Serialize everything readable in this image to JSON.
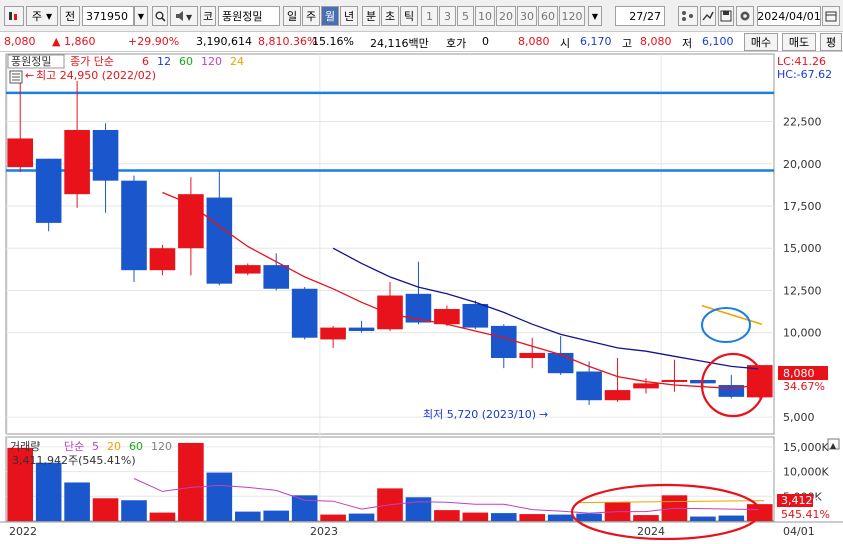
{
  "toolbar": {
    "period_label": "주",
    "market_label": "전",
    "code": "371950",
    "exchange_label": "코",
    "stock_name": "풍원정밀",
    "period_tabs": [
      "일",
      "주",
      "월",
      "년",
      "분",
      "초",
      "틱"
    ],
    "selected_period": "월",
    "interval_options": [
      "1",
      "3",
      "5",
      "10",
      "20",
      "30",
      "60",
      "120"
    ],
    "page_counter": "27/27",
    "date": "2024/04/01"
  },
  "infobar": {
    "price": "8,080",
    "change": "▲ 1,860",
    "change_pct": "+29.90%",
    "volume": "3,190,614",
    "volume_pct": "8,810.36%",
    "turnover_pct": "15.16%",
    "trade_value": "24,116백만",
    "quote_label": "호가",
    "quote_value": "0",
    "last_price": "8,080",
    "open_label": "시",
    "open": "6,170",
    "high_label": "고",
    "high": "8,080",
    "low_label": "저",
    "low": "6,100",
    "buy_label": "매수",
    "sell_label": "매도",
    "avg_label": "평"
  },
  "chart_data": [
    {
      "type": "candlestick",
      "panel_label": "풍원정밀",
      "ma_legend_prefix": "종가 단순",
      "ma_legend": [
        {
          "period": "6",
          "color": "#e8121b"
        },
        {
          "period": "12",
          "color": "#1a3bd6"
        },
        {
          "period": "60",
          "color": "#18a818"
        },
        {
          "period": "120",
          "color": "#c040c0"
        },
        {
          "period": "24",
          "color": "#f0a000"
        }
      ],
      "right_labels": {
        "lc": "LC:41.26",
        "hc": "HC:-67.62",
        "last_price": "8,080",
        "last_pct": "34.67%"
      },
      "y_ticks": [
        "22,500",
        "20,000",
        "17,500",
        "15,000",
        "12,500",
        "10,000",
        "5,000"
      ],
      "ylim": [
        4000,
        26500
      ],
      "x_labels": [
        "2022",
        "2023",
        "2024"
      ],
      "x_end_label": "04/01",
      "high_annotation": "최고 24,950 (2022/02)",
      "low_annotation": "최저 5,720 (2023/10)",
      "horizontal_lines": [
        24200,
        19600
      ],
      "candles": [
        {
          "o": 19800,
          "h": 24950,
          "l": 19500,
          "c": 21500
        },
        {
          "o": 20300,
          "h": 20300,
          "l": 16000,
          "c": 16500
        },
        {
          "o": 18200,
          "h": 24900,
          "l": 17400,
          "c": 22000
        },
        {
          "o": 22000,
          "h": 22400,
          "l": 17100,
          "c": 19000
        },
        {
          "o": 19000,
          "h": 19300,
          "l": 13000,
          "c": 13700
        },
        {
          "o": 13700,
          "h": 15200,
          "l": 13400,
          "c": 15000
        },
        {
          "o": 15000,
          "h": 19200,
          "l": 13400,
          "c": 18200
        },
        {
          "o": 18000,
          "h": 19600,
          "l": 12800,
          "c": 12900
        },
        {
          "o": 13500,
          "h": 14100,
          "l": 13400,
          "c": 14000
        },
        {
          "o": 14000,
          "h": 14700,
          "l": 12500,
          "c": 12600
        },
        {
          "o": 12600,
          "h": 12700,
          "l": 9600,
          "c": 9700
        },
        {
          "o": 9600,
          "h": 10400,
          "l": 9100,
          "c": 10300
        },
        {
          "o": 10300,
          "h": 10700,
          "l": 10000,
          "c": 10100
        },
        {
          "o": 10200,
          "h": 13000,
          "l": 10100,
          "c": 12200
        },
        {
          "o": 12300,
          "h": 14200,
          "l": 10500,
          "c": 10600
        },
        {
          "o": 10500,
          "h": 11600,
          "l": 10400,
          "c": 11400
        },
        {
          "o": 11700,
          "h": 11900,
          "l": 10200,
          "c": 10300
        },
        {
          "o": 10400,
          "h": 10500,
          "l": 7900,
          "c": 8500
        },
        {
          "o": 8500,
          "h": 9700,
          "l": 7900,
          "c": 8800
        },
        {
          "o": 8800,
          "h": 9800,
          "l": 7500,
          "c": 7600
        },
        {
          "o": 7700,
          "h": 8300,
          "l": 5720,
          "c": 6000
        },
        {
          "o": 6000,
          "h": 8500,
          "l": 5900,
          "c": 6600
        },
        {
          "o": 6700,
          "h": 7300,
          "l": 6400,
          "c": 7000
        },
        {
          "o": 7100,
          "h": 8400,
          "l": 6500,
          "c": 7200
        },
        {
          "o": 7200,
          "h": 7300,
          "l": 6800,
          "c": 7000
        },
        {
          "o": 6900,
          "h": 7500,
          "l": 6100,
          "c": 6200
        },
        {
          "o": 6170,
          "h": 8080,
          "l": 6100,
          "c": 8080
        }
      ],
      "ma6": [
        null,
        null,
        null,
        null,
        null,
        18300,
        17600,
        16300,
        15100,
        14200,
        13300,
        12600,
        11800,
        11100,
        10800,
        10500,
        10100,
        9700,
        9200,
        8700,
        8000,
        7400,
        7100,
        6900,
        6800,
        6700,
        6900
      ],
      "ma12": [
        null,
        null,
        null,
        null,
        null,
        null,
        null,
        null,
        null,
        null,
        null,
        15000,
        14100,
        13300,
        12700,
        12300,
        11800,
        11200,
        10500,
        9900,
        9500,
        9100,
        8900,
        8600,
        8300,
        8000,
        7850
      ],
      "trend_line": [
        10500,
        11600
      ]
    },
    {
      "type": "bar",
      "panel_label": "거래량",
      "ma_legend_prefix": "단순",
      "ma_legend": [
        {
          "period": "5",
          "color": "#c040c0"
        },
        {
          "period": "20",
          "color": "#f0a000"
        },
        {
          "period": "60",
          "color": "#18a818"
        },
        {
          "period": "120",
          "color": "#808080"
        }
      ],
      "volume_annotation": "3,411,942주(545.41%)",
      "y_ticks": [
        "15,000K",
        "10,000K",
        "5,000K"
      ],
      "ylim": [
        0,
        17000
      ],
      "right_labels": {
        "last_volume": "3,412K",
        "last_pct": "545.41%"
      },
      "values": [
        14800,
        11800,
        7800,
        4600,
        4200,
        1700,
        15800,
        9800,
        1900,
        2100,
        5200,
        1300,
        1500,
        6600,
        4800,
        2200,
        1700,
        1600,
        1400,
        1300,
        1500,
        3800,
        1200,
        5200,
        900,
        1100,
        3412
      ],
      "up": [
        true,
        false,
        false,
        true,
        false,
        true,
        true,
        false,
        false,
        false,
        false,
        true,
        false,
        true,
        false,
        true,
        true,
        false,
        true,
        false,
        false,
        true,
        true,
        true,
        false,
        false,
        true
      ],
      "ma5": [
        null,
        null,
        null,
        null,
        8600,
        6000,
        6800,
        7200,
        6800,
        6200,
        4200,
        4000,
        2400,
        3300,
        3900,
        3800,
        3400,
        3400,
        2300,
        2000,
        1600,
        1900,
        1900,
        2600,
        2500,
        2400,
        2300
      ]
    }
  ]
}
